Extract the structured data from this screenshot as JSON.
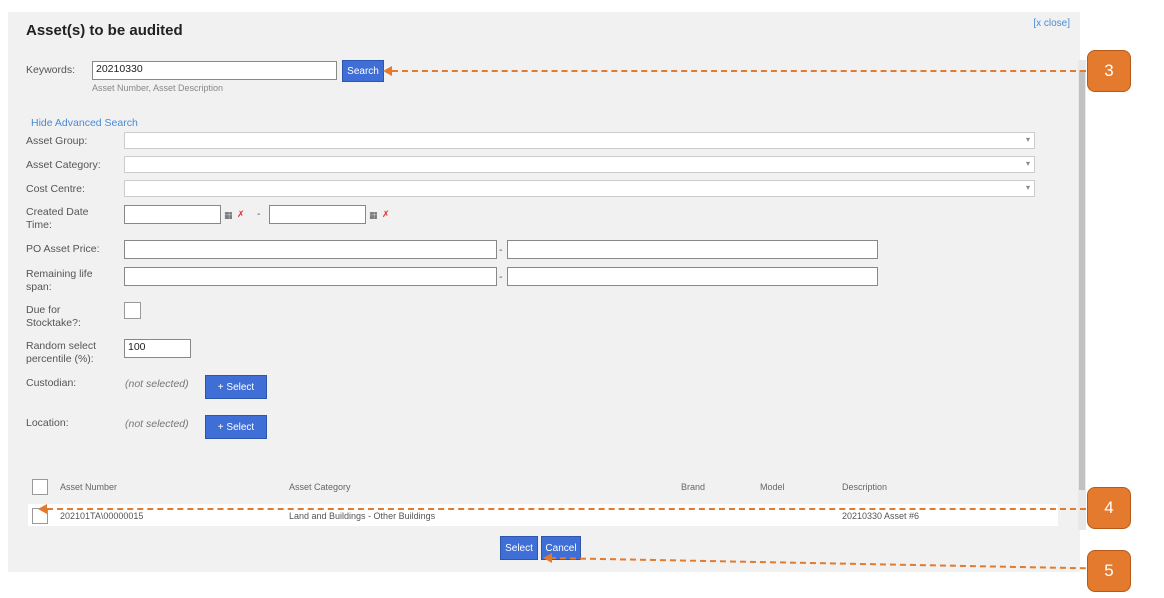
{
  "dialog": {
    "title": "Asset(s) to be audited",
    "close_label": "[x close]"
  },
  "search": {
    "keywords_label": "Keywords:",
    "keywords_value": "20210330",
    "keywords_hint": "Asset Number, Asset Description",
    "search_button": "Search",
    "toggle_advanced": "Hide Advanced Search"
  },
  "advanced": {
    "asset_group_label": "Asset Group:",
    "asset_category_label": "Asset Category:",
    "cost_centre_label": "Cost Centre:",
    "created_date_label_1": "Created Date",
    "created_date_label_2": "Time:",
    "date_separator": "-",
    "po_price_label": "PO Asset Price:",
    "range_separator": "-",
    "remaining_life_label_1": "Remaining life",
    "remaining_life_label_2": "span:",
    "due_stocktake_label_1": "Due for",
    "due_stocktake_label_2": "Stocktake?:",
    "random_label_1": "Random select",
    "random_label_2": "percentile (%):",
    "random_value": "100",
    "custodian_label": "Custodian:",
    "custodian_value": "(not selected)",
    "custodian_button": "+ Select",
    "location_label": "Location:",
    "location_value": "(not selected)",
    "location_button": "+ Select"
  },
  "table": {
    "columns": [
      "Asset Number",
      "Asset Category",
      "Brand",
      "Model",
      "Description"
    ],
    "rows": [
      {
        "asset_number": "202101TA\\00000015",
        "asset_category": "Land and Buildings - Other Buildings",
        "brand": "",
        "model": "",
        "description": "20210330 Asset #6"
      }
    ]
  },
  "footer": {
    "select_button": "Select",
    "cancel_button": "Cancel"
  },
  "callouts": [
    "3",
    "4",
    "5"
  ],
  "colors": {
    "accent": "#3f6fd6",
    "callout": "#e37a2d",
    "link": "#4a8ad6"
  }
}
